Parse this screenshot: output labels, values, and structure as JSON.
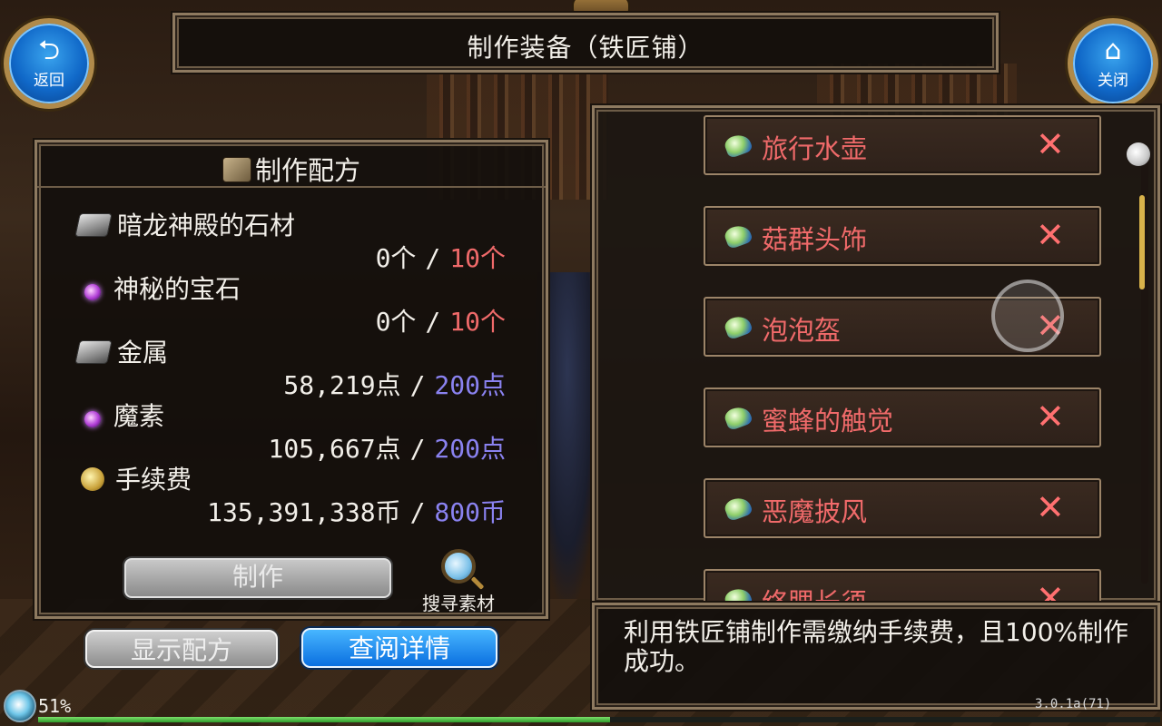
{
  "window": {
    "title": "制作装备（铁匠铺）"
  },
  "nav": {
    "back": {
      "icon": "back-arrow-icon",
      "label": "返回",
      "glyph": "⮌"
    },
    "close": {
      "icon": "home-icon",
      "label": "关闭",
      "glyph": "⌂"
    }
  },
  "recipe": {
    "header": "制作配方",
    "materials": [
      {
        "icon": "stone-icon",
        "name": "暗龙神殿的石材",
        "have": "0个",
        "need": "10个",
        "need_color": "red"
      },
      {
        "icon": "gem-icon",
        "name": "神秘的宝石",
        "have": "0个",
        "need": "10个",
        "need_color": "red"
      },
      {
        "icon": "stone-icon",
        "name": "金属",
        "have": "58,219点",
        "need": "200点",
        "need_color": "blue"
      },
      {
        "icon": "gem-icon",
        "name": "魔素",
        "have": "105,667点",
        "need": "200点",
        "need_color": "blue"
      },
      {
        "icon": "coin-icon",
        "name": "手续费",
        "have": "135,391,338币",
        "need": "800币",
        "need_color": "blue"
      }
    ],
    "separator": "/",
    "craft_label": "制作",
    "search_label": "搜寻素材"
  },
  "buttons": {
    "show_recipe": "显示配方",
    "view_details": "查阅详情"
  },
  "items": [
    {
      "name": "旅行水壶",
      "status": "✕"
    },
    {
      "name": "菇群头饰",
      "status": "✕"
    },
    {
      "name": "泡泡盔",
      "status": "✕"
    },
    {
      "name": "蜜蜂的触觉",
      "status": "✕"
    },
    {
      "name": "恶魔披风",
      "status": "✕"
    },
    {
      "name": "络腮长须",
      "status": "✕"
    }
  ],
  "description": "利用铁匠铺制作需缴纳手续费，且100%制作成功。",
  "status": {
    "progress_text": "51%",
    "progress_value": 0.51,
    "version": "3.0.1a(71)"
  },
  "colors": {
    "missing": "#f06a6a",
    "sufficient_need": "#8a82f0",
    "accent_blue": "#0a6fe0",
    "frame": "#8e7a60"
  }
}
